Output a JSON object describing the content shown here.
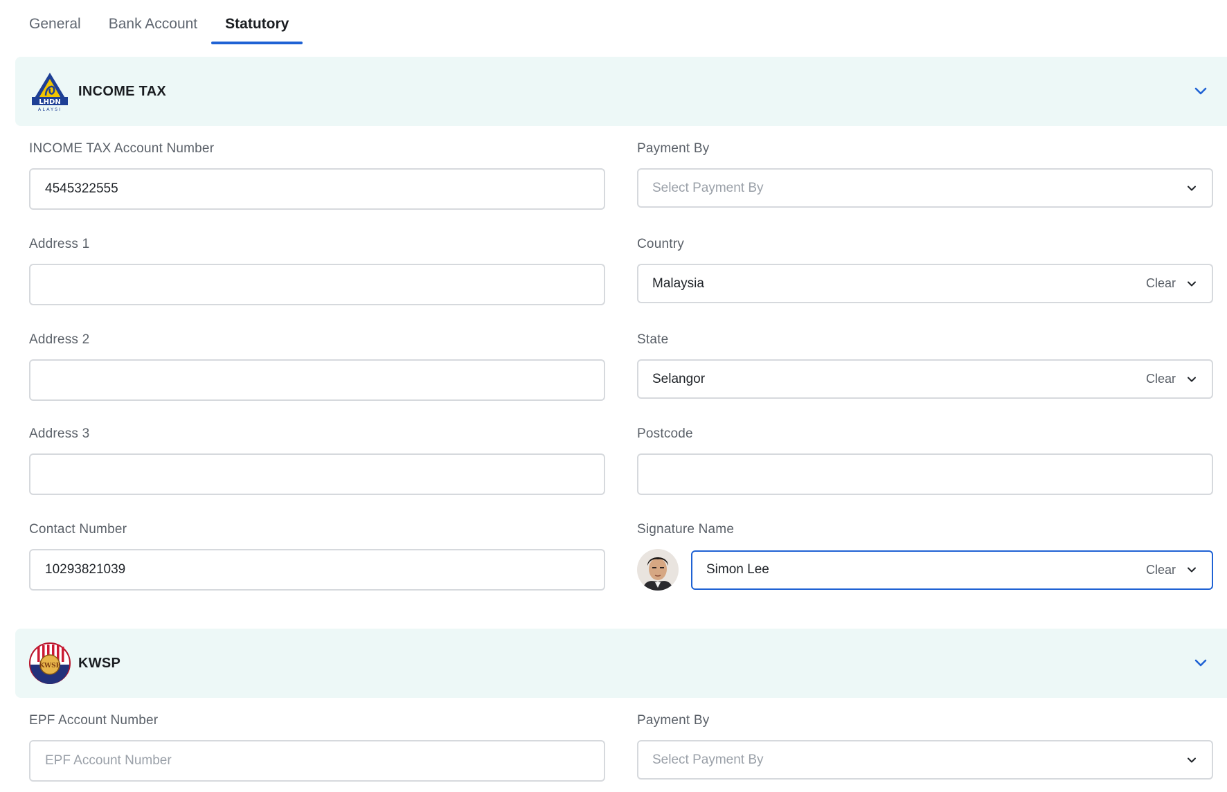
{
  "tabs": [
    {
      "label": "General"
    },
    {
      "label": "Bank Account"
    },
    {
      "label": "Statutory"
    }
  ],
  "income_tax": {
    "title": "INCOME TAX",
    "logo_text": "LHDN",
    "logo_subtext": "ALAYSI",
    "account_number": {
      "label": "INCOME TAX Account Number",
      "value": "4545322555"
    },
    "payment_by": {
      "label": "Payment By",
      "placeholder": "Select Payment By"
    },
    "address1": {
      "label": "Address 1",
      "value": ""
    },
    "country": {
      "label": "Country",
      "value": "Malaysia",
      "clear": "Clear"
    },
    "address2": {
      "label": "Address 2",
      "value": ""
    },
    "state": {
      "label": "State",
      "value": "Selangor",
      "clear": "Clear"
    },
    "address3": {
      "label": "Address 3",
      "value": ""
    },
    "postcode": {
      "label": "Postcode",
      "value": ""
    },
    "contact_number": {
      "label": "Contact Number",
      "value": "10293821039"
    },
    "signature_name": {
      "label": "Signature Name",
      "value": "Simon Lee",
      "clear": "Clear"
    }
  },
  "kwsp": {
    "title": "KWSP",
    "logo_text": "KWSP",
    "epf_account": {
      "label": "EPF Account Number",
      "placeholder": "EPF Account Number"
    },
    "payment_by": {
      "label": "Payment By",
      "placeholder": "Select Payment By"
    }
  },
  "colors": {
    "accent": "#1f62d4",
    "section_bg": "#edf8f7",
    "border": "#d6d9dd"
  },
  "icons": {
    "chevron": "chevron-down-icon",
    "caret": "caret-down-icon"
  }
}
